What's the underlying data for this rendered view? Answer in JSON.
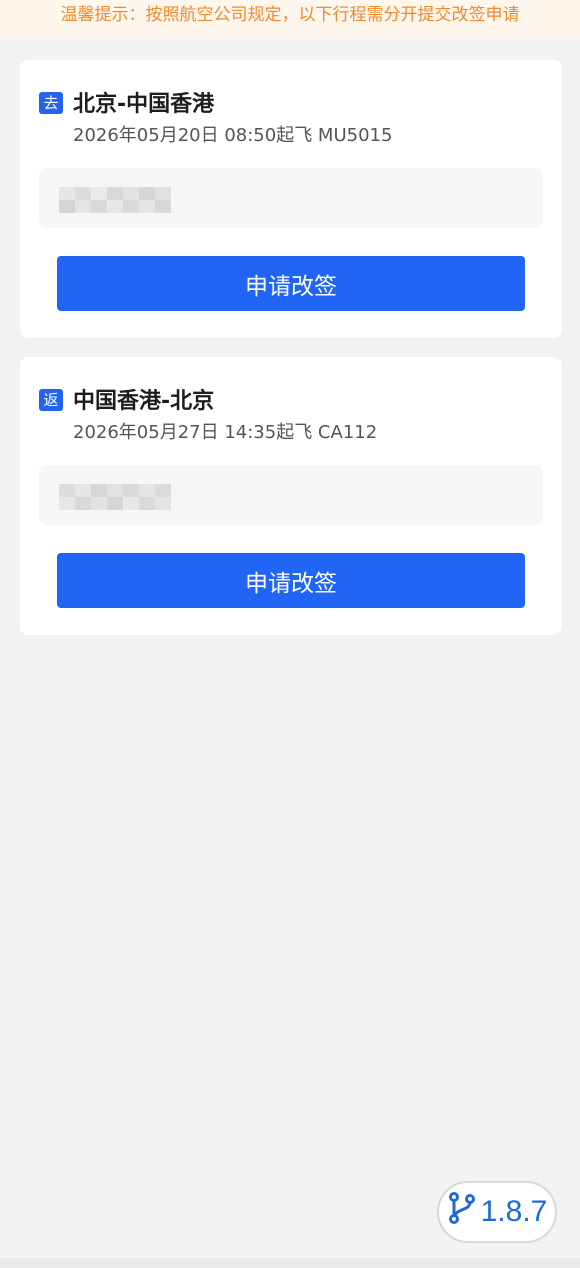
{
  "notice": {
    "text": "温馨提示：按照航空公司规定，以下行程需分开提交改签申请"
  },
  "trips": [
    {
      "tag": "去",
      "route": "北京-中国香港",
      "info": "2026年05月20日 08:50起飞 MU5015",
      "button_label": "申请改签"
    },
    {
      "tag": "返",
      "route": "中国香港-北京",
      "info": "2026年05月27日 14:35起飞 CA112",
      "button_label": "申请改签"
    }
  ],
  "version": {
    "icon": "git-branch-icon",
    "label": "1.8.7"
  },
  "colors": {
    "accent": "#2065f6",
    "notice_text": "#f08a2a",
    "notice_bg": "#fff6ee",
    "version_text": "#1e6bd8"
  }
}
